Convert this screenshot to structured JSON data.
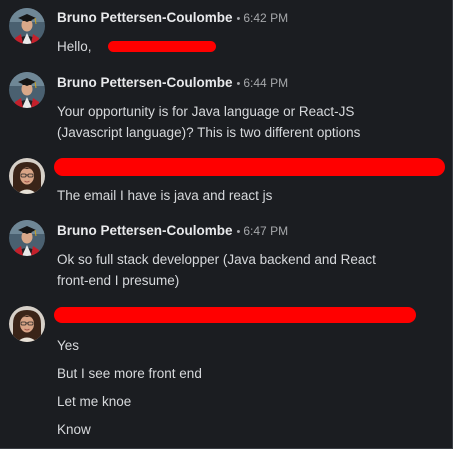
{
  "messages": [
    {
      "author": "Bruno Pettersen-Coulombe",
      "time": "6:42 PM",
      "lines": [
        "Hello,"
      ]
    },
    {
      "author": "Bruno Pettersen-Coulombe",
      "time": "6:44 PM",
      "lines": [
        "Your opportunity is for Java language or React-JS",
        "(Javascript language)? This is two different options"
      ]
    },
    {
      "author": "",
      "time": "",
      "lines": [
        "The email I have is java and react js"
      ]
    },
    {
      "author": "Bruno Pettersen-Coulombe",
      "time": "6:47 PM",
      "lines": [
        "Ok so full stack developper (Java backend and React",
        "front-end I presume)"
      ]
    },
    {
      "author": "",
      "time": "",
      "lines": [
        "Yes",
        "But I see more front end",
        "Let me knoe",
        "Know"
      ]
    }
  ],
  "separator": "•",
  "colors": {
    "background": "#1b1d21",
    "text": "#d7d9dc",
    "author": "#e8e9eb",
    "timestamp": "#a6a8ab",
    "redaction": "#ff0000"
  },
  "icons": {
    "bruno": "graduate-avatar-icon",
    "other": "woman-avatar-icon"
  }
}
